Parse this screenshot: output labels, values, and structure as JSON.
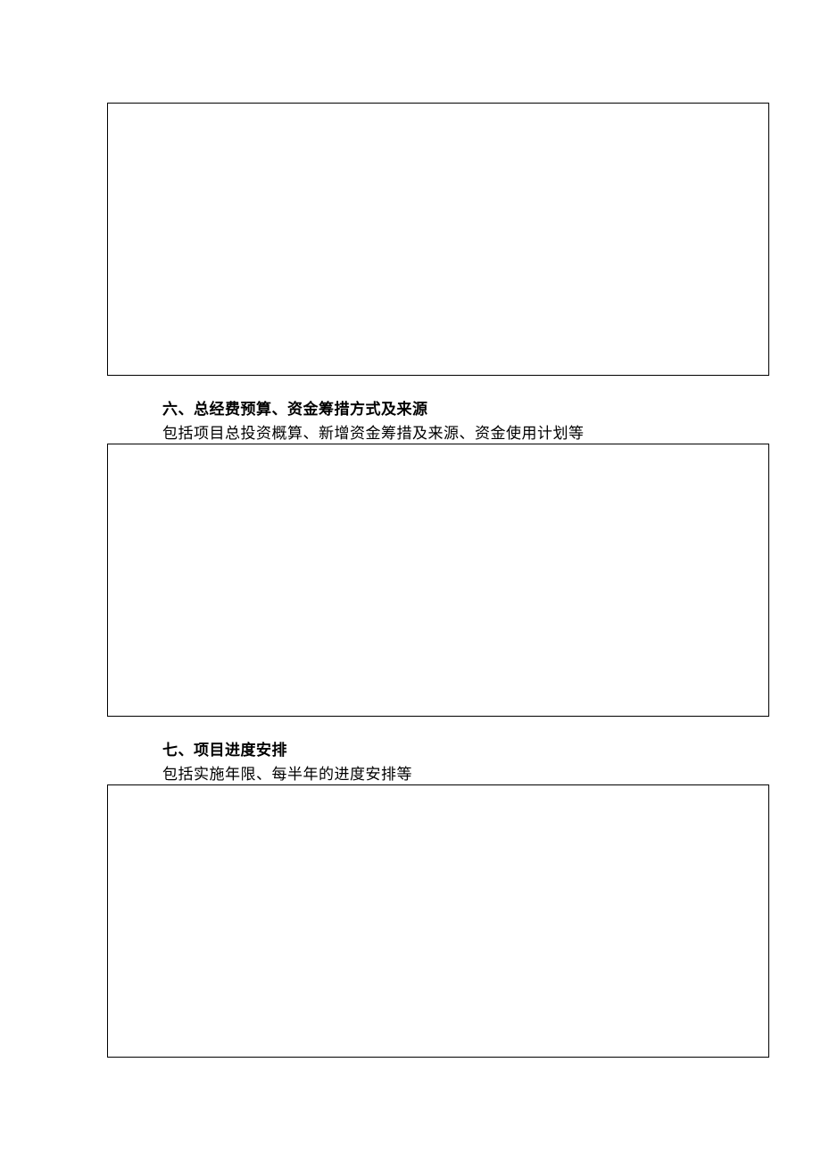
{
  "sections": {
    "section6": {
      "heading": "六、总经费预算、资金筹措方式及来源",
      "subtext": "包括项目总投资概算、新增资金筹措及来源、资金使用计划等"
    },
    "section7": {
      "heading": "七、项目进度安排",
      "subtext": "包括实施年限、每半年的进度安排等"
    }
  }
}
